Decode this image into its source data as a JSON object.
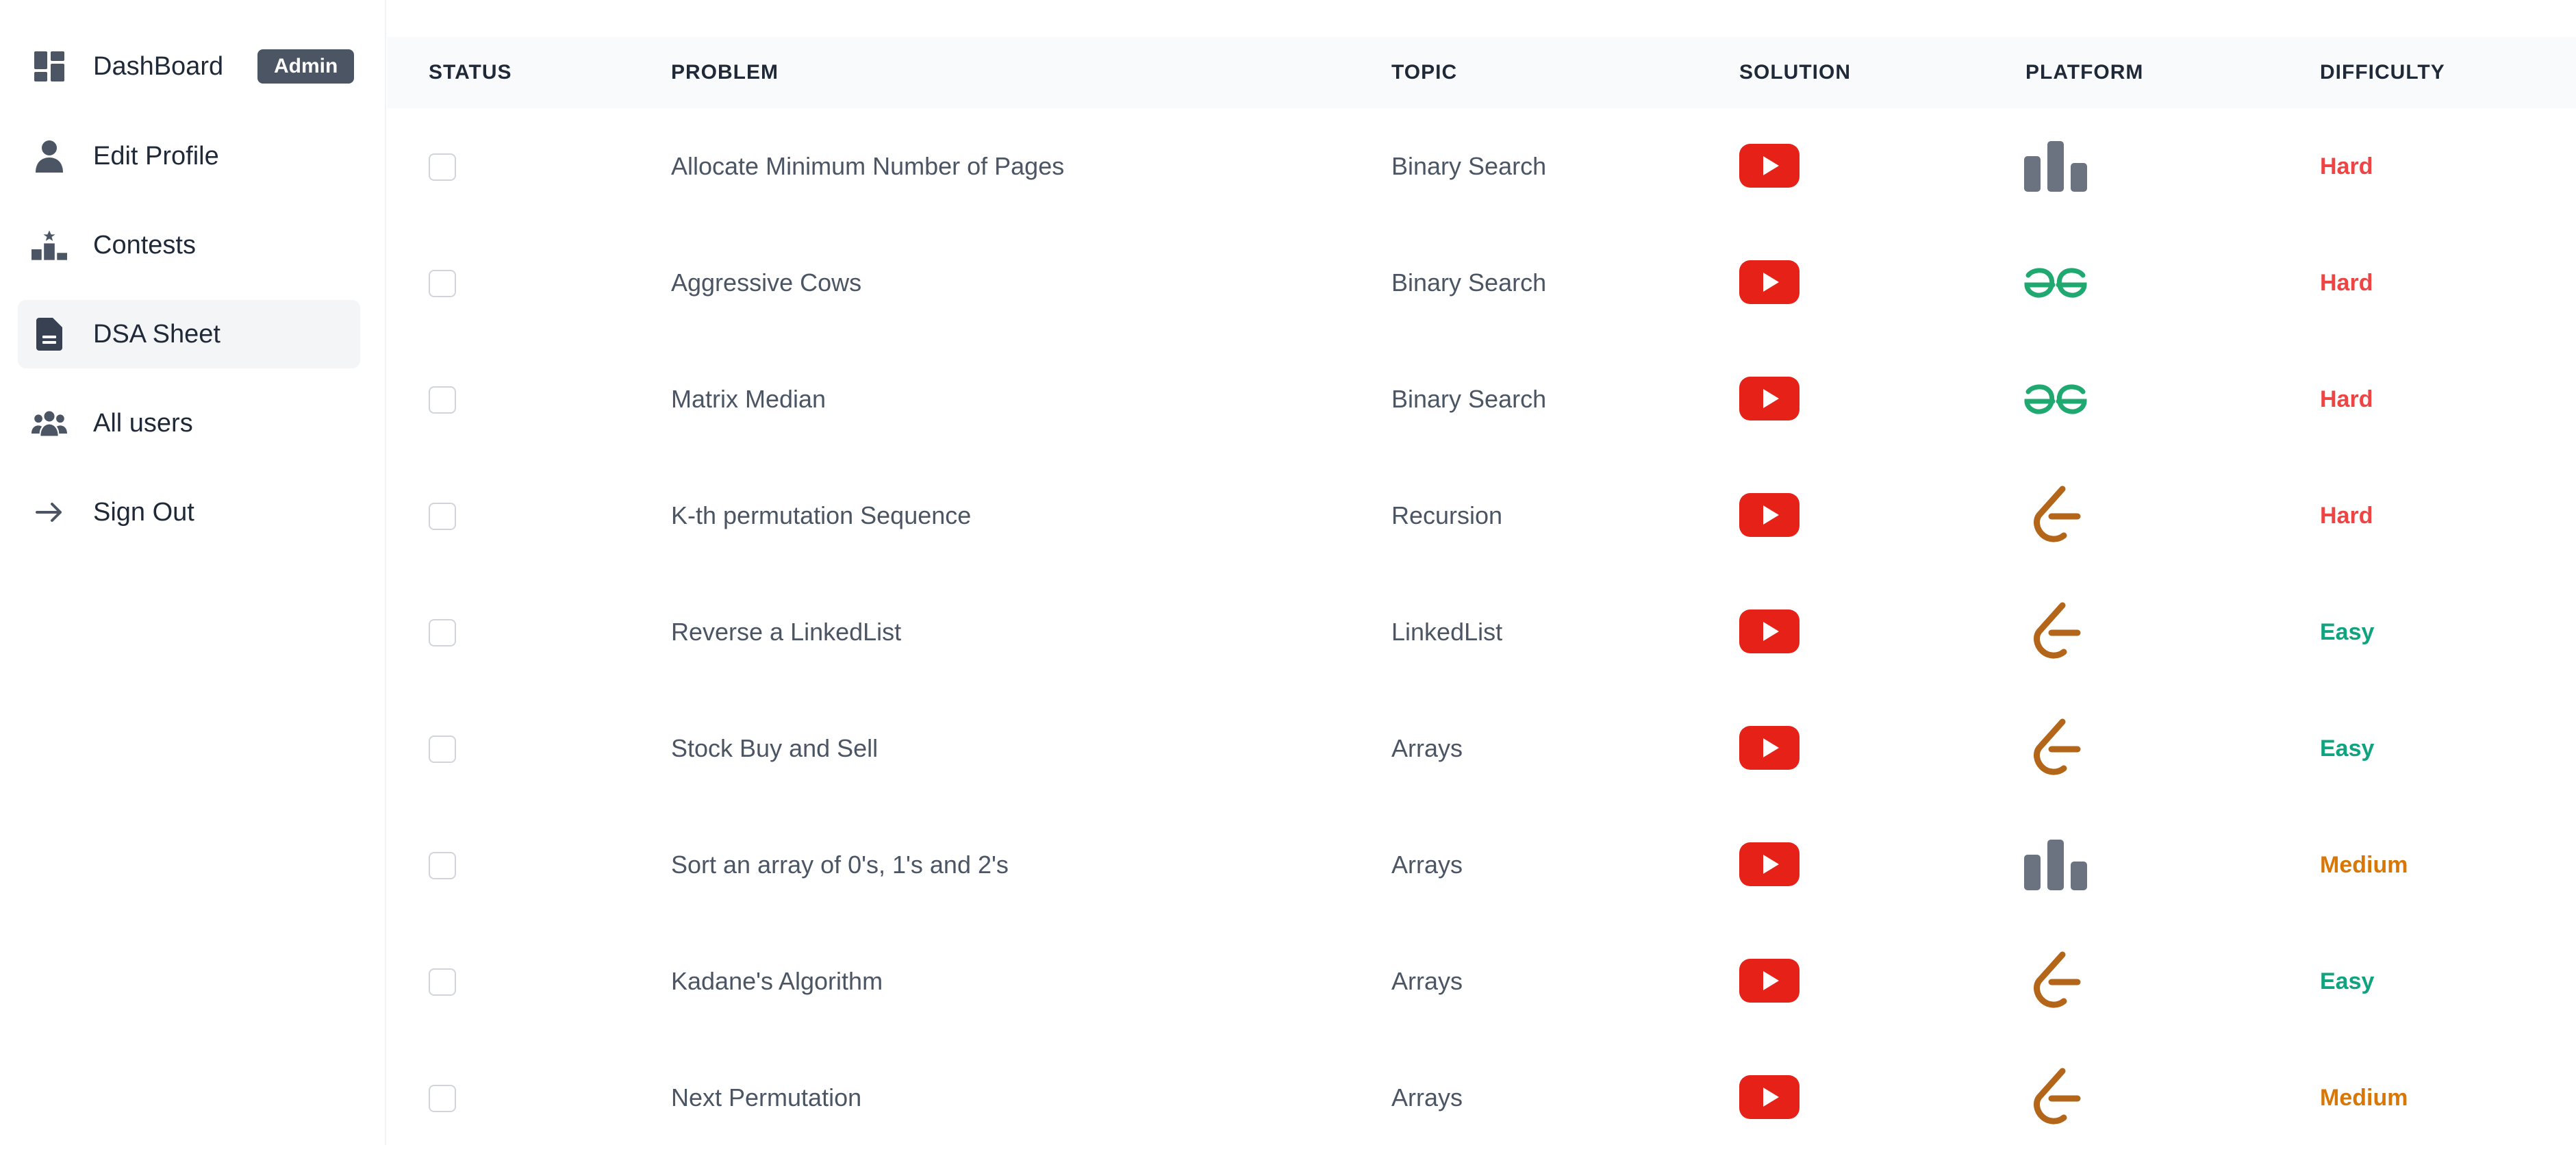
{
  "sidebar": {
    "items": [
      {
        "label": "DashBoard",
        "icon": "dashboard-icon"
      },
      {
        "label": "Edit Profile",
        "icon": "user-icon"
      },
      {
        "label": "Contests",
        "icon": "podium-icon"
      },
      {
        "label": "DSA Sheet",
        "icon": "document-icon"
      },
      {
        "label": "All users",
        "icon": "users-icon"
      },
      {
        "label": "Sign Out",
        "icon": "arrow-right-icon"
      }
    ],
    "badge": "Admin",
    "active_item": "DSA Sheet"
  },
  "table": {
    "headers": [
      "STATUS",
      "PROBLEM",
      "TOPIC",
      "SOLUTION",
      "PLATFORM",
      "DIFFICULTY"
    ],
    "rows": [
      {
        "problem": "Allocate Minimum Number of Pages",
        "topic": "Binary Search",
        "solution_icon": "youtube-icon",
        "platform": "codingninjas-icon",
        "difficulty": "Hard"
      },
      {
        "problem": "Aggressive Cows",
        "topic": "Binary Search",
        "solution_icon": "youtube-icon",
        "platform": "geeksforgeeks-icon",
        "difficulty": "Hard"
      },
      {
        "problem": "Matrix Median",
        "topic": "Binary Search",
        "solution_icon": "youtube-icon",
        "platform": "geeksforgeeks-icon",
        "difficulty": "Hard"
      },
      {
        "problem": "K-th permutation Sequence",
        "topic": "Recursion",
        "solution_icon": "youtube-icon",
        "platform": "leetcode-icon",
        "difficulty": "Hard"
      },
      {
        "problem": "Reverse a LinkedList",
        "topic": "LinkedList",
        "solution_icon": "youtube-icon",
        "platform": "leetcode-icon",
        "difficulty": "Easy"
      },
      {
        "problem": "Stock Buy and Sell",
        "topic": "Arrays",
        "solution_icon": "youtube-icon",
        "platform": "leetcode-icon",
        "difficulty": "Easy"
      },
      {
        "problem": "Sort an array of 0's, 1's and 2's",
        "topic": "Arrays",
        "solution_icon": "youtube-icon",
        "platform": "codingninjas-icon",
        "difficulty": "Medium"
      },
      {
        "problem": "Kadane's Algorithm",
        "topic": "Arrays",
        "solution_icon": "youtube-icon",
        "platform": "leetcode-icon",
        "difficulty": "Easy"
      },
      {
        "problem": "Next Permutation",
        "topic": "Arrays",
        "solution_icon": "youtube-icon",
        "platform": "leetcode-icon",
        "difficulty": "Medium"
      }
    ]
  },
  "colors": {
    "hard": "#ef4444",
    "easy": "#10a37f",
    "medium": "#d97706",
    "youtube": "#e62117",
    "leetcode": "#b3661a",
    "gfg": "#1fa971",
    "codingninjas": "#6b7280",
    "badge": "#4b5563"
  }
}
